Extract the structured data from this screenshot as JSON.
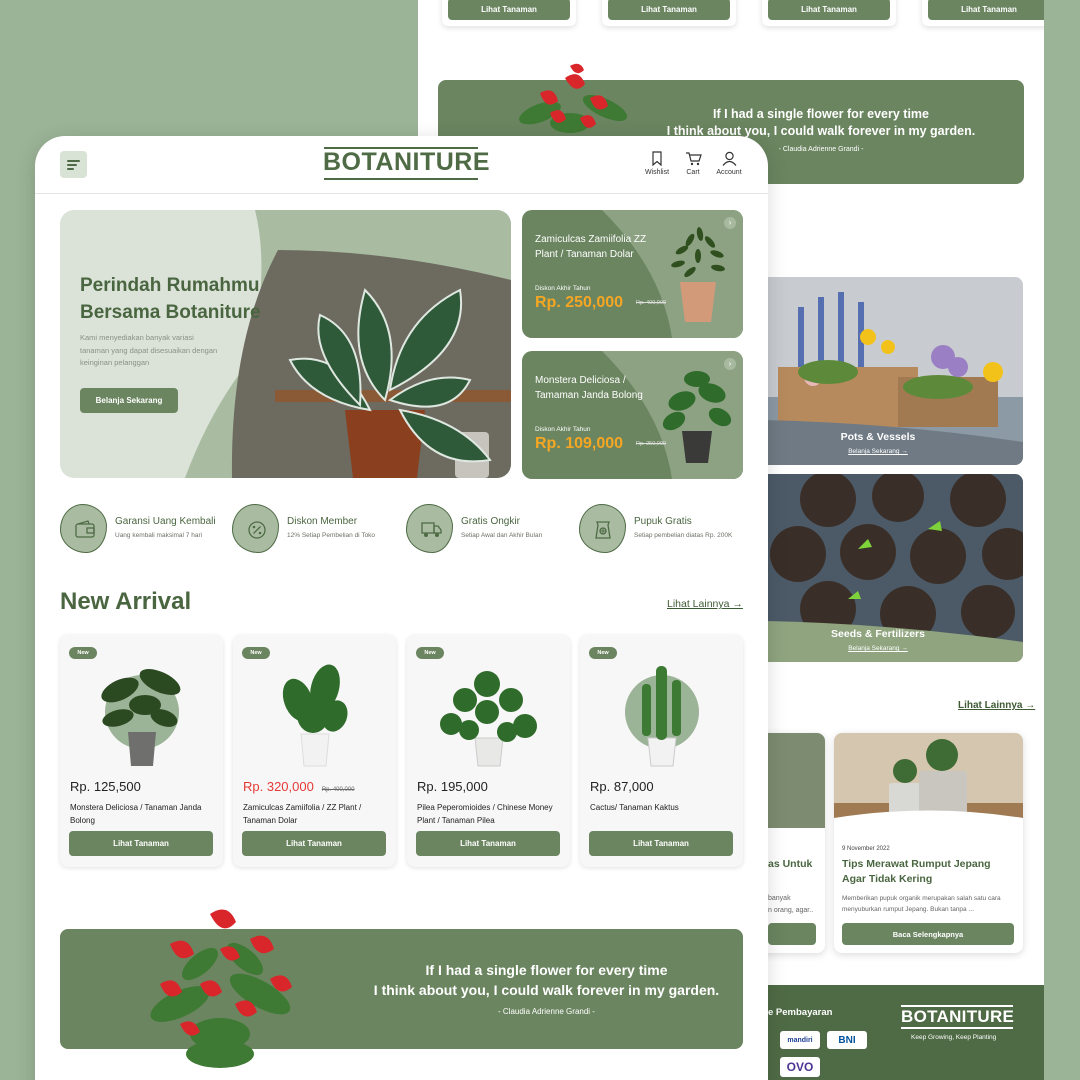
{
  "back": {
    "top_buttons": [
      "Lihat Tanaman",
      "Lihat Tanaman",
      "Lihat Tanaman",
      "Lihat Tanaman"
    ],
    "quote": {
      "line1": "If I had a single flower for every time",
      "line2": "I think about you, I could walk forever in my garden.",
      "author": "- Claudia Adrienne Grandi -"
    },
    "categories": [
      {
        "label": "Pots & Vessels",
        "link": "Belanja Sekarang →"
      },
      {
        "label": "Seeds & Fertilizers",
        "link": "Belanja Sekarang →"
      }
    ],
    "lihat_lainnya": "Lihat Lainnya →",
    "blog": {
      "partial_title": "as Untuk",
      "partial_desc_1": "banyak",
      "partial_desc_2": "n orang, agar..",
      "date": "9 November 2022",
      "title": "Tips Merawat Rumput Jepang Agar Tidak Kering",
      "desc": "Memberikan pupuk organik merupakan salah satu cara menyuburkan rumput Jepang. Bukan tanpa ...",
      "button": "Baca Selengkapnya"
    },
    "footer": {
      "payment_label": "e Pembayaran",
      "payments": [
        "mandiri",
        "BNI",
        "OVO"
      ],
      "brand": "BOTANITURE",
      "tagline": "Keep Growing, Keep Planting"
    }
  },
  "nav": {
    "logo": "BOTANITURE",
    "wishlist": "Wishlist",
    "cart": "Cart",
    "account": "Account"
  },
  "hero": {
    "title_line1": "Perindah Rumahmu",
    "title_line2": "Bersama Botaniture",
    "desc": "Kami menyediakan banyak variasi tanaman yang dapat disesuaikan dengan keinginan pelanggan",
    "button": "Belanja Sekarang"
  },
  "promos": [
    {
      "title": "Zamiculcas Zamiifolia ZZ Plant / Tanaman Dolar",
      "sub": "Diskon Akhir Tahun",
      "price": "Rp. 250,000",
      "old": "Rp. 400,000"
    },
    {
      "title": "Monstera  Deliciosa / Tamaman Janda Bolong",
      "sub": "Diskon Akhir Tahun",
      "price": "Rp. 109,000",
      "old": "Rp. 250,000"
    }
  ],
  "features": [
    {
      "title": "Garansi Uang Kembali",
      "sub": "Uang kembali maksimal 7 hari",
      "icon": "wallet-icon"
    },
    {
      "title": "Diskon Member",
      "sub": "12% Setiap Pembelian di Toko",
      "icon": "discount-icon"
    },
    {
      "title": "Gratis Ongkir",
      "sub": "Setiap Awal dan Akhir Bulan",
      "icon": "truck-icon"
    },
    {
      "title": "Pupuk Gratis",
      "sub": "Setiap pembelian diatas Rp. 200K",
      "icon": "fertilizer-icon"
    }
  ],
  "new_arrival": {
    "title": "New Arrival",
    "link": "Lihat Lainnya →",
    "products": [
      {
        "badge": "New",
        "price": "Rp. 125,500",
        "old": "",
        "name": "Monstera Deliciosa / Tanaman Janda Bolong",
        "button": "Lihat Tanaman"
      },
      {
        "badge": "New",
        "price": "Rp. 320,000",
        "old": "Rp. 400,000",
        "name": "Zamiculcas Zamiifolia / ZZ Plant / Tanaman Dolar",
        "button": "Lihat Tanaman"
      },
      {
        "badge": "New",
        "price": "Rp. 195,000",
        "old": "",
        "name": "Pilea Peperomioides / Chinese Money Plant / Tanaman Pilea",
        "button": "Lihat Tanaman"
      },
      {
        "badge": "New",
        "price": "Rp. 87,000",
        "old": "",
        "name": "Cactus/ Tanaman Kaktus",
        "button": "Lihat Tanaman"
      }
    ]
  },
  "quote": {
    "line1": "If I had a single flower for every time",
    "line2": "I think about you, I could walk forever in my garden.",
    "author": "- Claudia Adrienne Grandi -"
  },
  "colors": {
    "primary": "#6b8560",
    "dark": "#4f6b45",
    "accent": "#f5a623",
    "sale": "#e53935",
    "background": "#9bb396"
  }
}
